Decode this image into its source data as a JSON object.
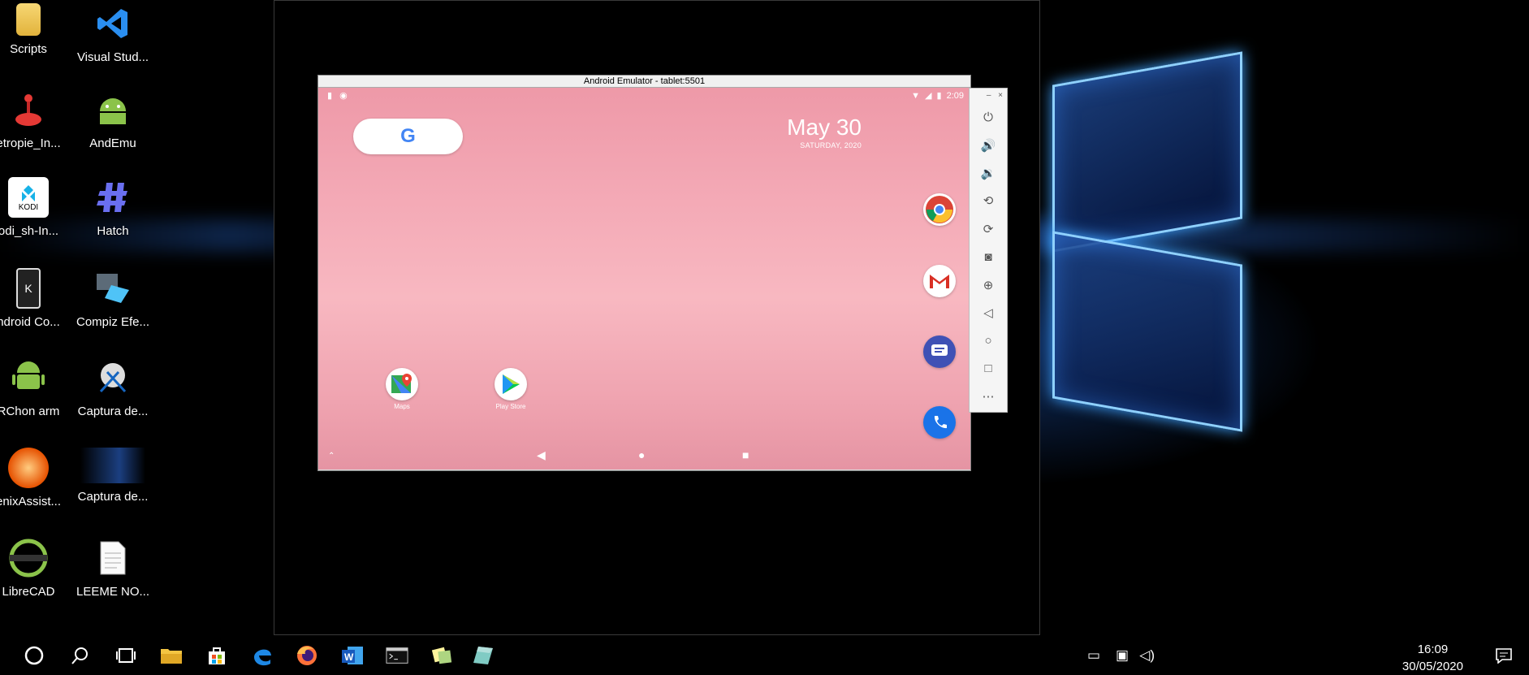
{
  "desktop": {
    "icons": [
      {
        "label": "Scripts",
        "icon": "folder-icon"
      },
      {
        "label": "Visual Stud...",
        "icon": "vscode-icon"
      },
      {
        "label": "etropie_In...",
        "icon": "joystick-icon"
      },
      {
        "label": "AndEmu",
        "icon": "android-icon"
      },
      {
        "label": "odi_sh-In...",
        "icon": "kodi-icon"
      },
      {
        "label": "Hatch",
        "icon": "hatch-icon"
      },
      {
        "label": "ndroid Co...",
        "icon": "kde-connect-icon"
      },
      {
        "label": "Compiz Efe...",
        "icon": "compiz-icon"
      },
      {
        "label": "RChon arm",
        "icon": "android-icon"
      },
      {
        "label": "Captura de...",
        "icon": "snipping-tool-icon"
      },
      {
        "label": "enixAssist...",
        "icon": "phoenix-icon"
      },
      {
        "label": "Captura de...",
        "icon": "screenshot-thumbnail-icon"
      },
      {
        "label": "LibreCAD",
        "icon": "librecad-icon"
      },
      {
        "label": "LEEME NO...",
        "icon": "text-file-icon"
      }
    ]
  },
  "emulator": {
    "title": "Android Emulator - tablet:5501",
    "status_bar": {
      "time": "2:09"
    },
    "google_letter": "G",
    "date_widget": {
      "date": "May 30",
      "weekday": "SATURDAY, 2020"
    },
    "home_apps": [
      {
        "label": "Maps",
        "icon": "maps-icon"
      },
      {
        "label": "Play Store",
        "icon": "play-store-icon"
      }
    ],
    "dock": [
      "chrome-icon",
      "gmail-icon",
      "messages-icon",
      "phone-icon"
    ],
    "controls": {
      "minimize": "–",
      "close": "×",
      "buttons": [
        "power",
        "volume-up",
        "volume-down",
        "rotate-left",
        "rotate-right",
        "screenshot",
        "zoom",
        "back",
        "home",
        "overview",
        "more"
      ]
    }
  },
  "taskbar": {
    "apps": [
      "start-icon",
      "search-icon",
      "task-view-icon",
      "file-explorer-icon",
      "store-icon",
      "edge-icon",
      "firefox-icon",
      "word-icon",
      "cmd-icon",
      "sticky-notes-icon",
      "snip-icon"
    ],
    "clock": {
      "time": "16:09",
      "date": "30/05/2020"
    }
  },
  "colors": {
    "android_wallpaper": "#f3a7b4",
    "taskbar": "#000000",
    "win_glow": "#3fa2ff"
  }
}
